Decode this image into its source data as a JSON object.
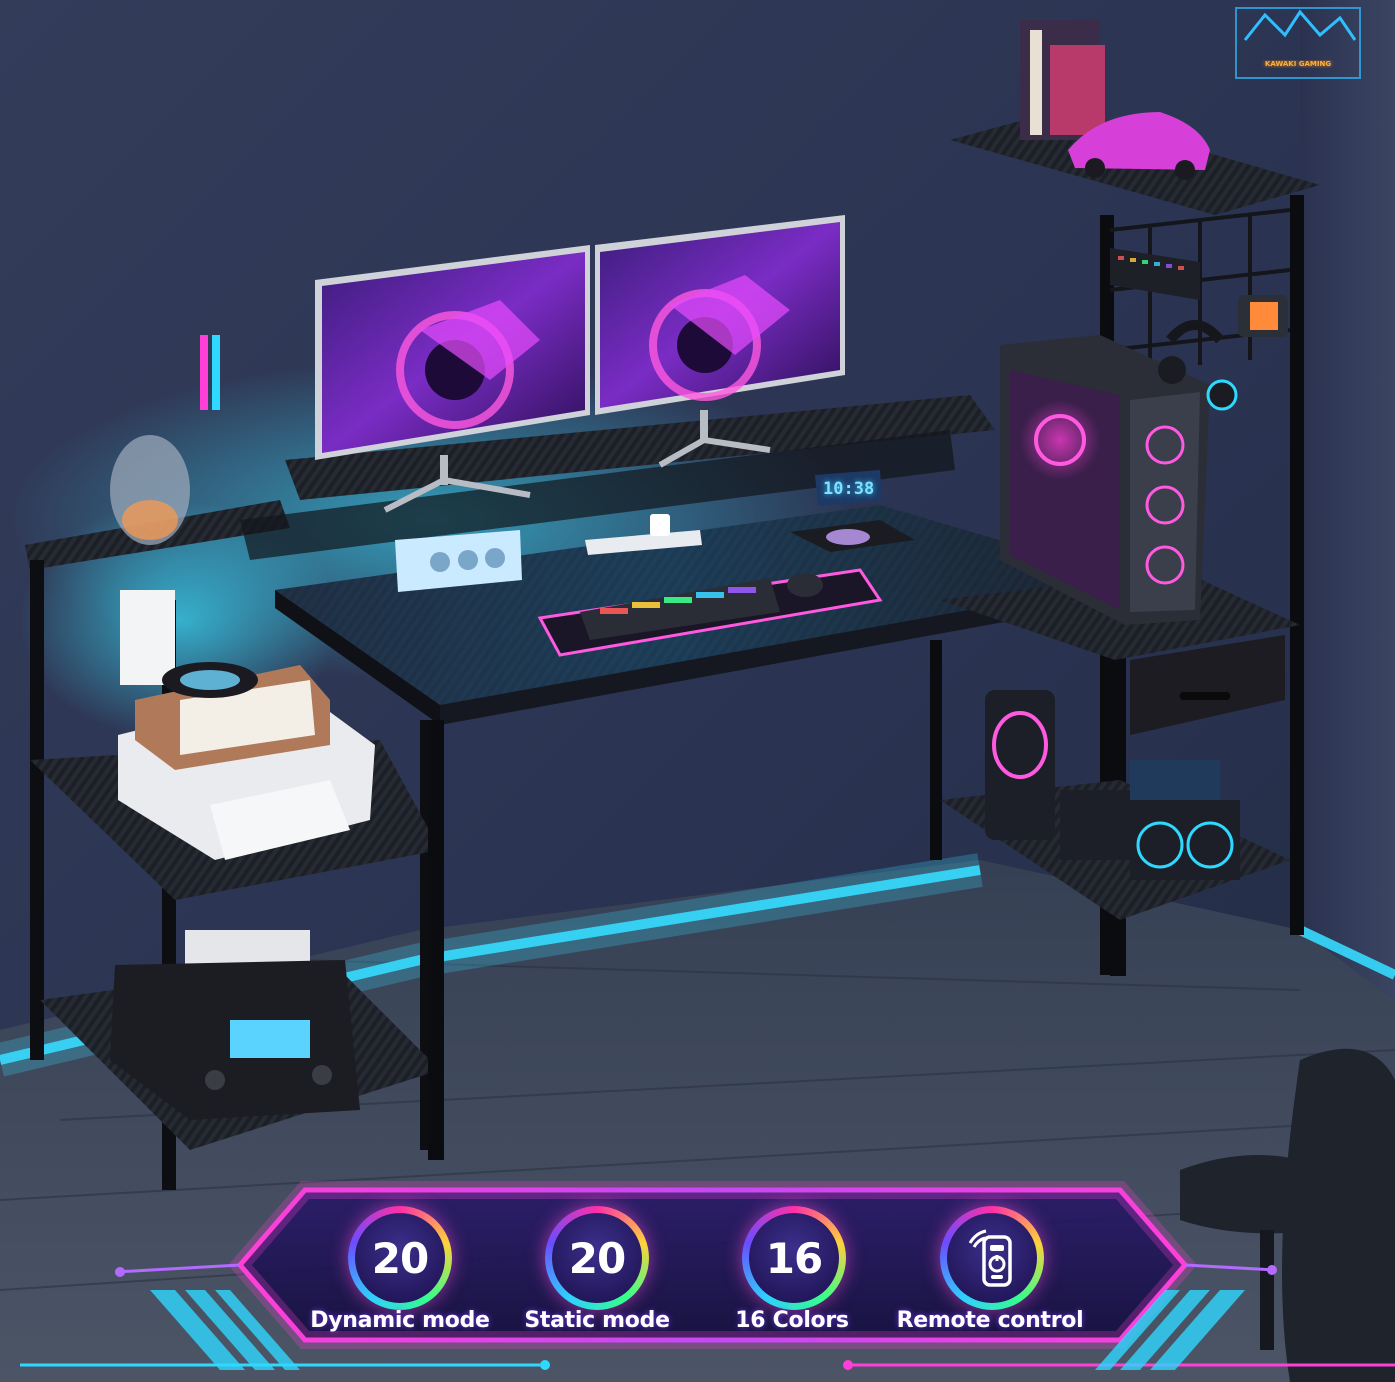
{
  "scene": {
    "description_key": "gaming-desk-with-rgb-lighting",
    "colors": {
      "wall": "#2a3450",
      "floor": "#3b4453",
      "led_blue": "#2fd8ff",
      "led_pink": "#ff38d6",
      "desk_carbon": "#1c1e24",
      "frame_black": "#0d0e12",
      "banner_bg": "#1b1450"
    },
    "clock_display": "10:38",
    "sign_text": "KAWAKI GAMING"
  },
  "features": [
    {
      "value": "20",
      "label": "Dynamic mode",
      "icon": ""
    },
    {
      "value": "20",
      "label": "Static mode",
      "icon": ""
    },
    {
      "value": "16",
      "label": "16 Colors",
      "icon": ""
    },
    {
      "value": "",
      "label": "Remote control",
      "icon": "remote-control-icon"
    }
  ]
}
